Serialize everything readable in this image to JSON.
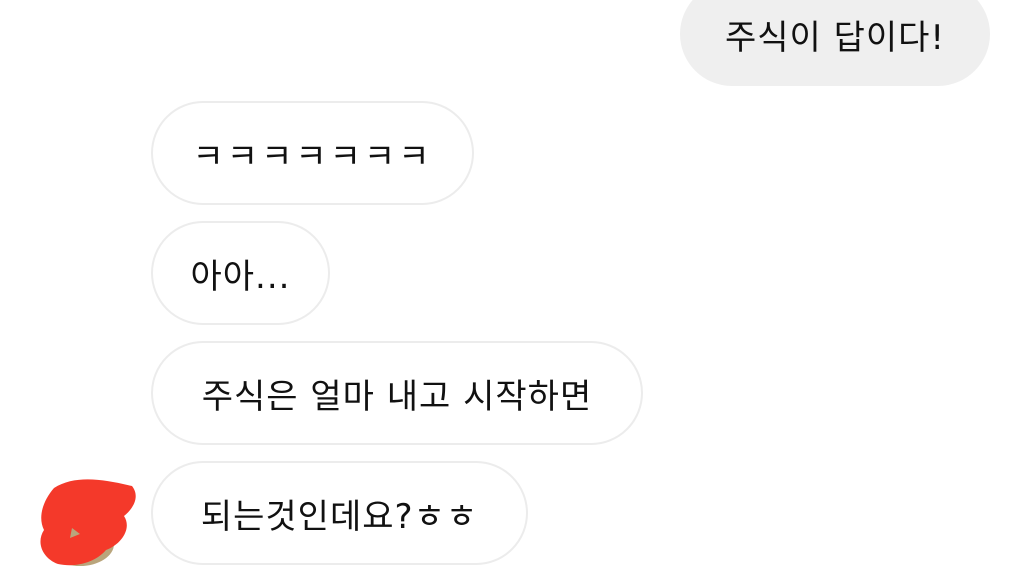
{
  "conversation": {
    "messages": [
      {
        "direction": "sent",
        "text": "주식이 답이다!"
      },
      {
        "direction": "received",
        "text": "ㅋㅋㅋㅋㅋㅋㅋ"
      },
      {
        "direction": "received",
        "text": "아아..."
      },
      {
        "direction": "received",
        "text": "주식은 얼마 내고 시작하면"
      },
      {
        "direction": "received",
        "text": "되는것인데요?ㅎㅎ"
      }
    ]
  },
  "avatar": {
    "icon": "profile-avatar-redacted",
    "redaction_color": "#f4392a"
  }
}
